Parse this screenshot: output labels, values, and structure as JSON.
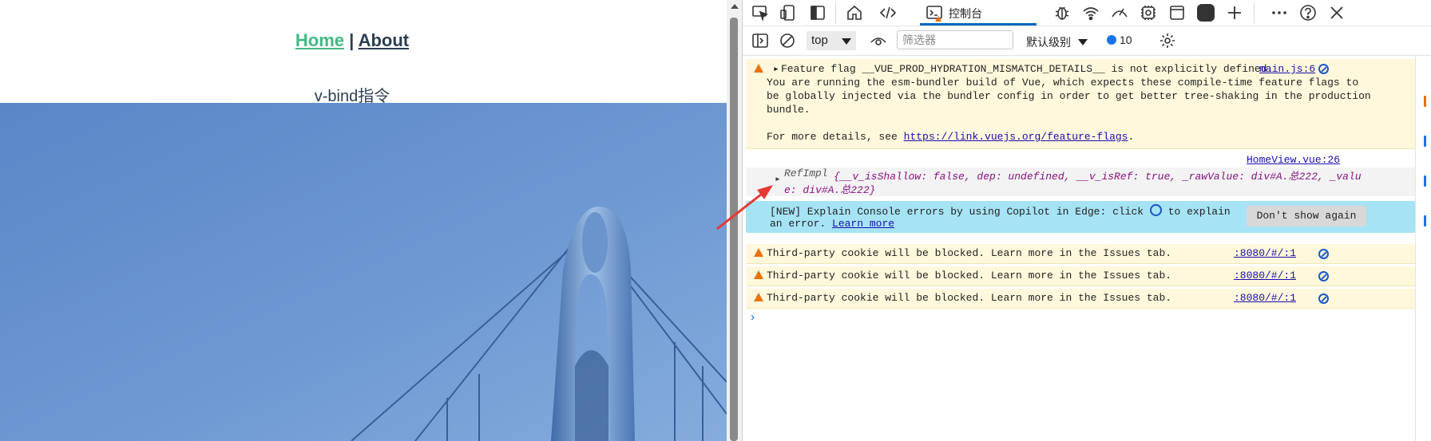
{
  "page": {
    "nav": {
      "home": "Home",
      "separator": "|",
      "about": "About"
    },
    "heading": "v-bind指令"
  },
  "devtools": {
    "console_tab": "控制台",
    "context": "top",
    "filter_placeholder": "筛选器",
    "levels": "默认级别",
    "issues_count": "10",
    "messages": {
      "flag": {
        "line1": "Feature flag __VUE_PROD_HYDRATION_MISMATCH_DETAILS__ is not explicitly defined.",
        "line2": "You are running the esm-bundler build of Vue, which expects these compile-time feature flags to",
        "line3": "be globally injected via the bundler config in order to get better tree-shaking in the production",
        "line4": "bundle.",
        "line5_prefix": "For more details, see",
        "link": "https://link.vuejs.org/feature-flags",
        "line5_suffix": ".",
        "source": "main.js:6"
      },
      "ref": {
        "source": "HomeView.vue:26",
        "class": "RefImpl",
        "line1": "{__v_isShallow: false, dep: undefined, __v_isRef: true, _rawValue: div#A.总222, _valu",
        "line2": "e: div#A.总222}"
      },
      "copilot": {
        "line1_prefix": "[NEW] Explain Console errors by using Copilot in Edge: click",
        "line1_suffix": "to explain",
        "line2_prefix": "an error.",
        "learn_more": "Learn more",
        "dismiss": "Don't show again"
      },
      "cookies": [
        {
          "text": "Third-party cookie will be blocked. Learn more in the Issues tab.",
          "source": ":8080/#/:1"
        },
        {
          "text": "Third-party cookie will be blocked. Learn more in the Issues tab.",
          "source": ":8080/#/:1"
        },
        {
          "text": "Third-party cookie will be blocked. Learn more in the Issues tab.",
          "source": ":8080/#/:1"
        }
      ],
      "prompt": "›"
    }
  },
  "colors": {
    "vue_green": "#42b983",
    "text_dark": "#2c3e50",
    "warning_bg": "#fff8dc",
    "warning_icon": "#e8710a",
    "copilot_bg": "#a6e3f5",
    "link_blue": "#1a0dab",
    "accent_blue": "#0067c0"
  },
  "icons": [
    "inspect-icon",
    "device-icon",
    "dock-icon",
    "home-icon",
    "elements-icon",
    "console-icon",
    "sources-icon",
    "network-icon",
    "performance-icon",
    "settings-gear-icon",
    "application-icon",
    "record-icon",
    "plus-icon",
    "more-icon",
    "help-icon",
    "close-icon",
    "sidebar-icon",
    "clear-icon",
    "eye-icon",
    "warning-icon",
    "copilot-icon"
  ]
}
